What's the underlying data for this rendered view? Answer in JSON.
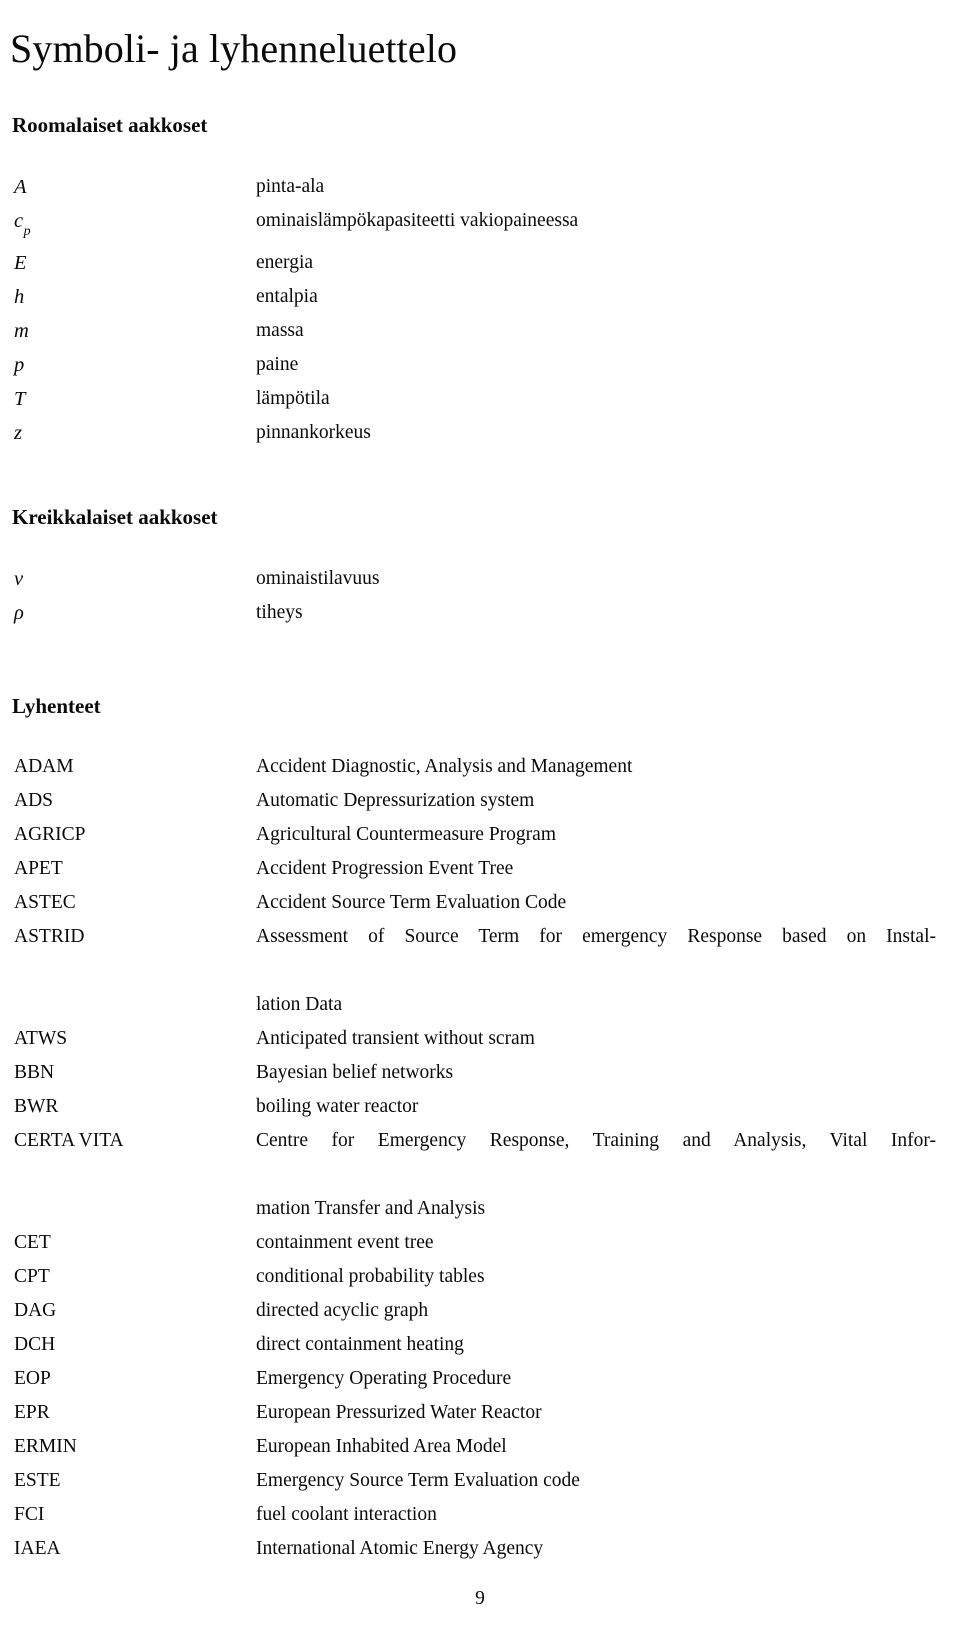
{
  "document": {
    "title": "Symboli- ja lyhenneluettelo",
    "page_number": "9"
  },
  "sections": [
    {
      "id": "roman",
      "heading": "Roomalaiset aakkoset",
      "entries": [
        {
          "symbol": "A",
          "sub": "",
          "description": "pinta-ala"
        },
        {
          "symbol": "c",
          "sub": "p",
          "description": "ominaislämpökapasiteetti vakiopaineessa"
        },
        {
          "symbol": "E",
          "sub": "",
          "description": "energia"
        },
        {
          "symbol": "h",
          "sub": "",
          "description": "entalpia"
        },
        {
          "symbol": "m",
          "sub": "",
          "description": "massa"
        },
        {
          "symbol": "p",
          "sub": "",
          "description": "paine"
        },
        {
          "symbol": "T",
          "sub": "",
          "description": "lämpötila"
        },
        {
          "symbol": "z",
          "sub": "",
          "description": "pinnankorkeus"
        }
      ]
    },
    {
      "id": "greek",
      "heading": "Kreikkalaiset aakkoset",
      "entries": [
        {
          "symbol": "ν",
          "sub": "",
          "description": "ominaistilavuus"
        },
        {
          "symbol": "ρ",
          "sub": "",
          "description": "tiheys"
        }
      ]
    }
  ],
  "abbreviations": {
    "heading": "Lyhenteet",
    "entries": [
      {
        "abbr": "ADAM",
        "line1": "Accident Diagnostic, Analysis and Management",
        "line2": ""
      },
      {
        "abbr": "ADS",
        "line1": "Automatic Depressurization system",
        "line2": ""
      },
      {
        "abbr": "AGRICP",
        "line1": "Agricultural Countermeasure Program",
        "line2": ""
      },
      {
        "abbr": "APET",
        "line1": "Accident Progression Event Tree",
        "line2": ""
      },
      {
        "abbr": "ASTEC",
        "line1": "Accident Source Term Evaluation Code",
        "line2": ""
      },
      {
        "abbr": "ASTRID",
        "line1": "Assessment of Source Term for emergency Response based on Instal-",
        "line2": "lation Data"
      },
      {
        "abbr": "ATWS",
        "line1": "Anticipated transient without scram",
        "line2": ""
      },
      {
        "abbr": "BBN",
        "line1": "Bayesian belief networks",
        "line2": ""
      },
      {
        "abbr": "BWR",
        "line1": "boiling water reactor",
        "line2": ""
      },
      {
        "abbr": "CERTA VITA",
        "line1": "Centre for Emergency Response, Training and Analysis, Vital Infor-",
        "line2": "mation Transfer and Analysis"
      },
      {
        "abbr": "CET",
        "line1": "containment event tree",
        "line2": ""
      },
      {
        "abbr": "CPT",
        "line1": "conditional probability tables",
        "line2": ""
      },
      {
        "abbr": "DAG",
        "line1": "directed acyclic graph",
        "line2": ""
      },
      {
        "abbr": "DCH",
        "line1": "direct containment heating",
        "line2": ""
      },
      {
        "abbr": "EOP",
        "line1": "Emergency Operating Procedure",
        "line2": ""
      },
      {
        "abbr": "EPR",
        "line1": "European Pressurized Water Reactor",
        "line2": ""
      },
      {
        "abbr": "ERMIN",
        "line1": "European Inhabited Area Model",
        "line2": ""
      },
      {
        "abbr": "ESTE",
        "line1": "Emergency Source Term Evaluation code",
        "line2": ""
      },
      {
        "abbr": "FCI",
        "line1": "fuel coolant interaction",
        "line2": ""
      },
      {
        "abbr": "IAEA",
        "line1": "International Atomic Energy Agency",
        "line2": ""
      }
    ]
  }
}
